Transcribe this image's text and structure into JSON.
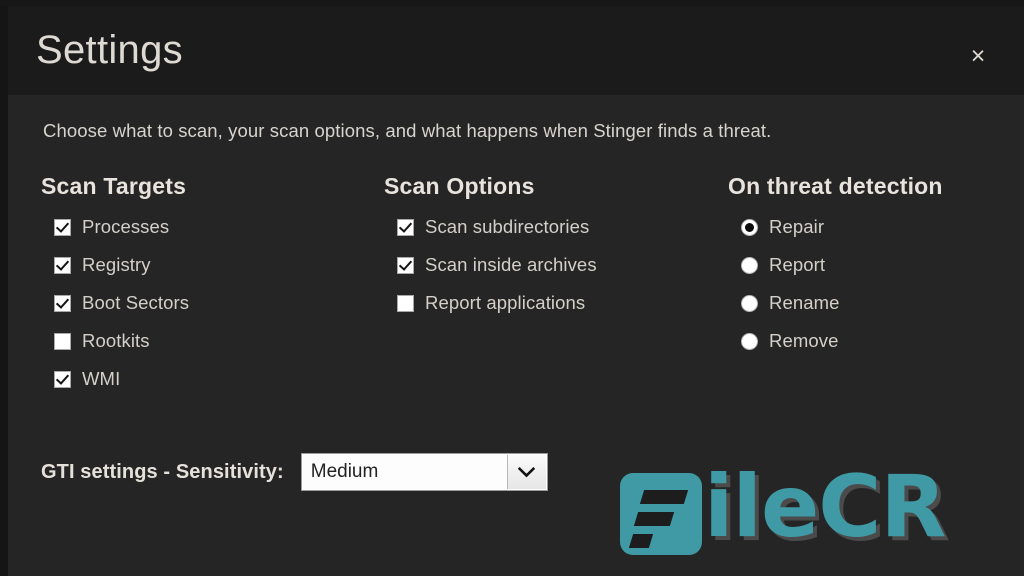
{
  "window": {
    "title": "Settings",
    "close_icon": "close-icon",
    "close_label": "×"
  },
  "body": {
    "subtitle": "Choose what to scan, your scan options, and what happens when Stinger finds a threat."
  },
  "scan_targets": {
    "heading": "Scan Targets",
    "items": [
      {
        "label": "Processes",
        "checked": true
      },
      {
        "label": "Registry",
        "checked": true
      },
      {
        "label": "Boot Sectors",
        "checked": true
      },
      {
        "label": "Rootkits",
        "checked": false
      },
      {
        "label": "WMI",
        "checked": true
      }
    ]
  },
  "scan_options": {
    "heading": "Scan Options",
    "items": [
      {
        "label": "Scan subdirectories",
        "checked": true
      },
      {
        "label": "Scan inside archives",
        "checked": true
      },
      {
        "label": "Report applications",
        "checked": false
      }
    ]
  },
  "threat_detection": {
    "heading": "On threat detection",
    "items": [
      {
        "label": "Repair",
        "selected": true
      },
      {
        "label": "Report",
        "selected": false
      },
      {
        "label": "Rename",
        "selected": false
      },
      {
        "label": "Remove",
        "selected": false
      }
    ]
  },
  "gti": {
    "label": "GTI settings - Sensitivity:",
    "selected": "Medium",
    "dropdown_icon": "chevron-down-icon"
  },
  "watermark": {
    "text": "ileCR",
    "mark_icon": "filecr-logo-icon",
    "color": "#3f9aa6"
  },
  "colors": {
    "titlebar_bg": "#1b1b1b",
    "body_bg": "#252525",
    "text": "#d8d4cd",
    "heading": "#e8e4dd",
    "accent": "#3f9aa6"
  }
}
